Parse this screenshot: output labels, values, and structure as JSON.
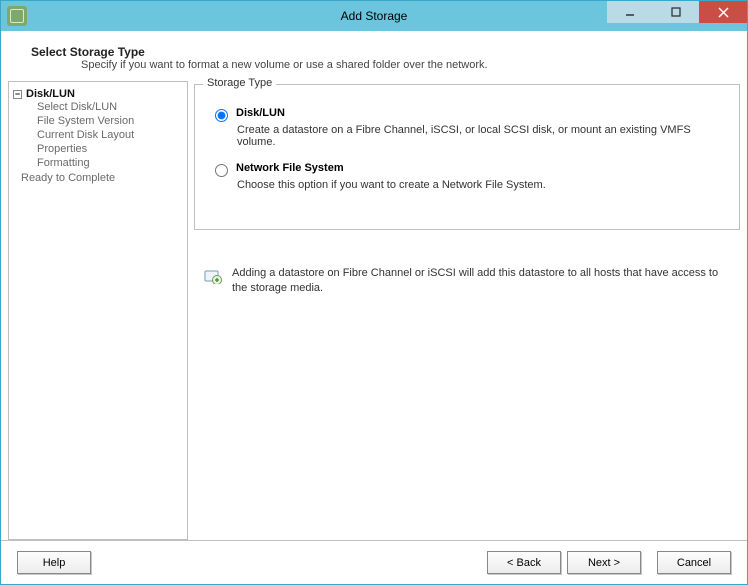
{
  "window": {
    "title": "Add Storage"
  },
  "header": {
    "title": "Select Storage Type",
    "desc": "Specify if you want to format a new volume or use a shared folder over the network."
  },
  "sidebar": {
    "root": "Disk/LUN",
    "items": [
      "Select Disk/LUN",
      "File System Version",
      "Current Disk Layout",
      "Properties",
      "Formatting"
    ],
    "final": "Ready to Complete"
  },
  "group": {
    "legend": "Storage Type",
    "options": [
      {
        "label": "Disk/LUN",
        "desc": "Create a datastore on a Fibre Channel, iSCSI, or local SCSI disk, or mount an existing VMFS volume.",
        "selected": true
      },
      {
        "label": "Network File System",
        "desc": "Choose this option if you want to create a Network File System.",
        "selected": false
      }
    ]
  },
  "info": "Adding a datastore on Fibre Channel or iSCSI will add this datastore to all hosts that have access to the storage media.",
  "footer": {
    "help": "Help",
    "back": "< Back",
    "next": "Next >",
    "cancel": "Cancel"
  }
}
